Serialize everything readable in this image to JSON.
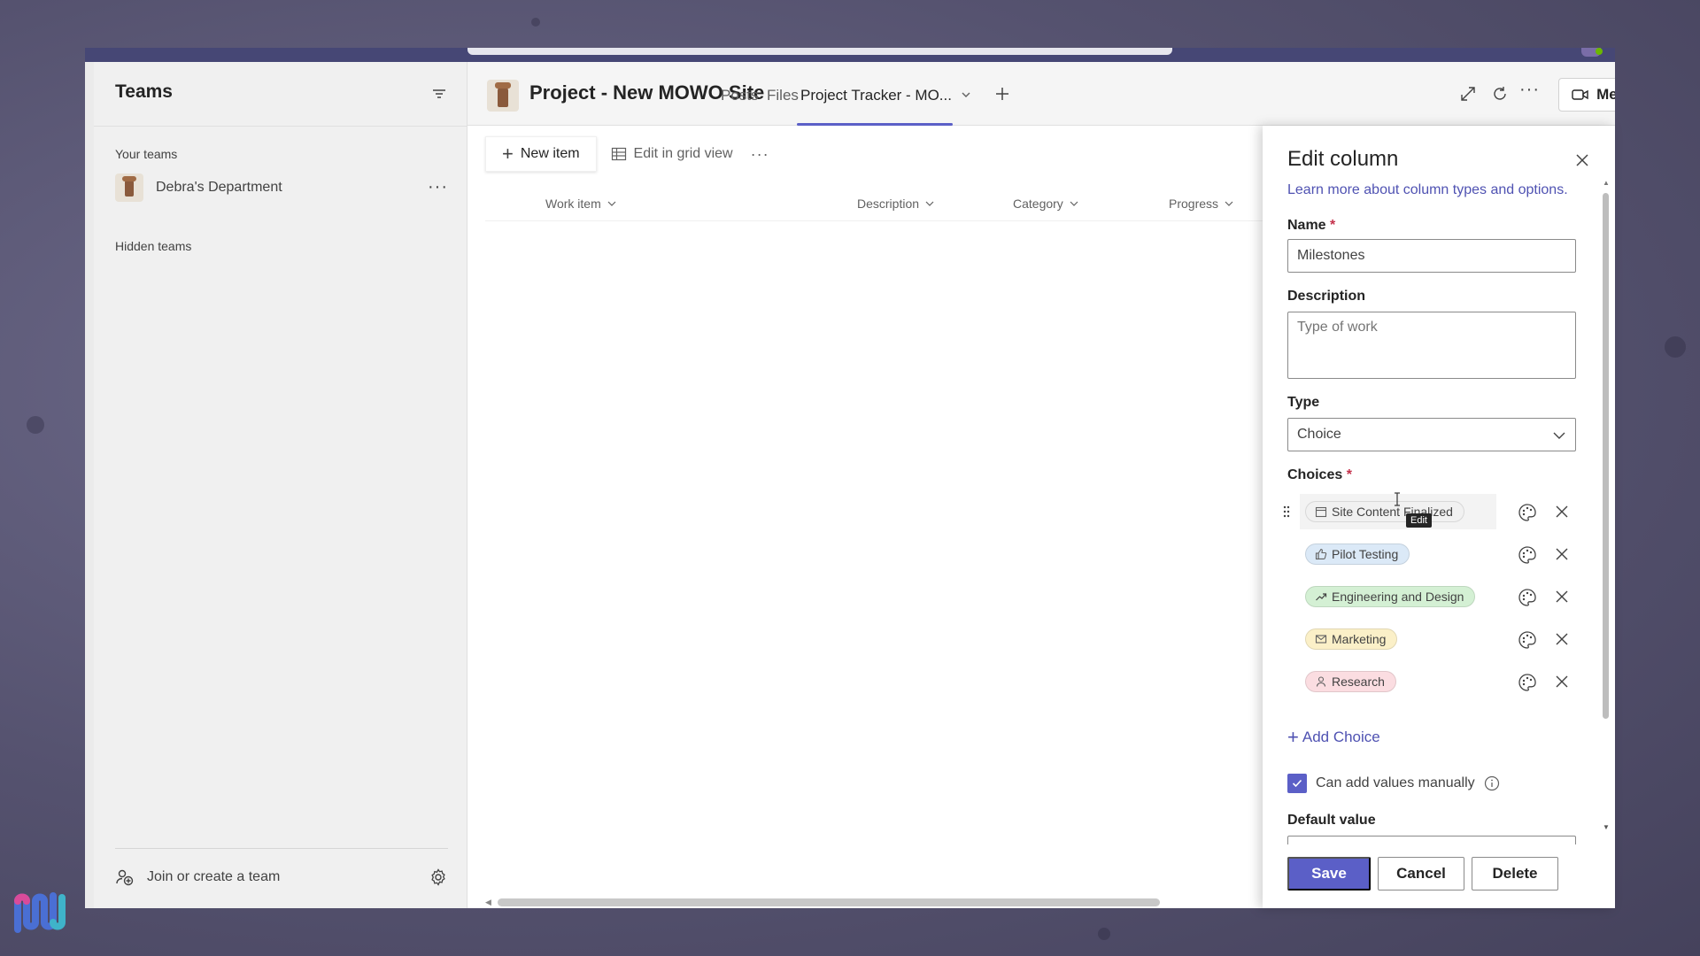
{
  "sidebar": {
    "title": "Teams",
    "your_teams_label": "Your teams",
    "team_name": "Debra's Department",
    "hidden_teams_label": "Hidden teams",
    "join_label": "Join or create a team"
  },
  "header": {
    "channel_title": "Project - New MOWO Site",
    "tabs": [
      "Posts",
      "Files",
      "Project Tracker - MO..."
    ],
    "meet_label": "Meet"
  },
  "commands": {
    "new_item": "New item",
    "edit_grid": "Edit in grid view"
  },
  "columns": [
    "Work item",
    "Description",
    "Category",
    "Progress"
  ],
  "panel": {
    "title": "Edit column",
    "learn_link": "Learn more about column types and options.",
    "name_label": "Name",
    "name_value": "Milestones",
    "description_label": "Description",
    "description_placeholder": "Type of work",
    "type_label": "Type",
    "type_value": "Choice",
    "choices_label": "Choices",
    "required_mark": "*",
    "choices": [
      {
        "label": "Site Content Finalized",
        "icon": "calendar-icon",
        "color": "#f1f1f1"
      },
      {
        "label": "Pilot Testing",
        "icon": "thumbs-up-icon",
        "color": "#dbe9f7"
      },
      {
        "label": "Engineering and Design",
        "icon": "trending-up-icon",
        "color": "#d4f0d4"
      },
      {
        "label": "Marketing",
        "icon": "mail-icon",
        "color": "#fbf0c8"
      },
      {
        "label": "Research",
        "icon": "person-icon",
        "color": "#fbdde1"
      }
    ],
    "tooltip": "Edit",
    "add_choice": "Add Choice",
    "manual_values_label": "Can add values manually",
    "manual_values_checked": true,
    "default_value_label": "Default value",
    "save": "Save",
    "cancel": "Cancel",
    "delete": "Delete"
  },
  "colors": {
    "accent": "#5b5fc7",
    "link": "#4f52b2",
    "titlebar": "#464775"
  }
}
